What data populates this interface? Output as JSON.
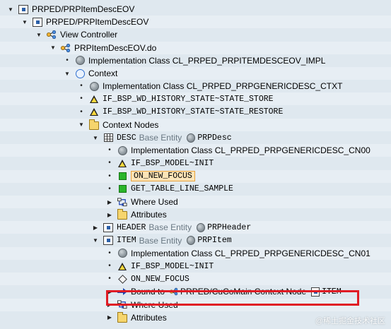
{
  "tree": [
    {
      "id": "root",
      "depth": 0,
      "toggle": "open",
      "icon": "node-box-icon",
      "segs": [
        {
          "t": "PRPED/PRPItemDescEOV",
          "s": "plain"
        }
      ]
    },
    {
      "id": "component",
      "depth": 1,
      "toggle": "open",
      "icon": "node-box-icon",
      "segs": [
        {
          "t": "PRPED/PRPItemDescEOV",
          "s": "plain"
        }
      ]
    },
    {
      "id": "view-controller",
      "depth": 2,
      "toggle": "open",
      "icon": "network-icon",
      "segs": [
        {
          "t": "View Controller",
          "s": "plain"
        }
      ]
    },
    {
      "id": "view",
      "depth": 3,
      "toggle": "open",
      "icon": "network-icon",
      "segs": [
        {
          "t": "PRPItemDescEOV.do",
          "s": "plain"
        }
      ]
    },
    {
      "id": "view-impl",
      "depth": 4,
      "toggle": "leaf",
      "icon": "class-circle-icon",
      "segs": [
        {
          "t": "Implementation Class CL_PRPED_PRPITEMDESCEOV_IMPL",
          "s": "plain"
        }
      ]
    },
    {
      "id": "context",
      "depth": 4,
      "toggle": "open",
      "icon": "context-ring-icon",
      "segs": [
        {
          "t": "Context",
          "s": "plain"
        }
      ]
    },
    {
      "id": "ctxt-impl",
      "depth": 5,
      "toggle": "leaf",
      "icon": "class-circle-icon",
      "segs": [
        {
          "t": "Implementation Class CL_PRPED_PRPGENERICDESC_CTXT",
          "s": "plain"
        }
      ]
    },
    {
      "id": "hist-store",
      "depth": 5,
      "toggle": "leaf",
      "icon": "warning-triangle-icon",
      "segs": [
        {
          "t": "IF_BSP_WD_HISTORY_STATE~STATE_STORE",
          "s": "mono"
        }
      ]
    },
    {
      "id": "hist-restore",
      "depth": 5,
      "toggle": "leaf",
      "icon": "warning-triangle-icon",
      "segs": [
        {
          "t": "IF_BSP_WD_HISTORY_STATE~STATE_RESTORE",
          "s": "mono"
        }
      ]
    },
    {
      "id": "context-nodes",
      "depth": 5,
      "toggle": "open",
      "icon": "folder-icon",
      "segs": [
        {
          "t": "Context Nodes",
          "s": "plain"
        }
      ]
    },
    {
      "id": "desc",
      "depth": 6,
      "toggle": "open",
      "icon": "table-grid-icon",
      "segs": [
        {
          "t": "DESC",
          "s": "mono"
        },
        {
          "t": "Base Entity",
          "s": "gray"
        },
        {
          "t": "",
          "s": "icon",
          "icon": "class-circle-icon"
        },
        {
          "t": "PRPDesc",
          "s": "mono"
        }
      ]
    },
    {
      "id": "desc-impl",
      "depth": 7,
      "toggle": "leaf",
      "icon": "class-circle-icon",
      "segs": [
        {
          "t": "Implementation Class CL_PRPED_PRPGENERICDESC_CN00",
          "s": "plain"
        }
      ]
    },
    {
      "id": "desc-init",
      "depth": 7,
      "toggle": "leaf",
      "icon": "warning-triangle-icon",
      "segs": [
        {
          "t": "IF_BSP_MODEL~INIT",
          "s": "mono"
        }
      ]
    },
    {
      "id": "desc-focus",
      "depth": 7,
      "toggle": "leaf",
      "icon": "green-square-icon",
      "selected": true,
      "segs": [
        {
          "t": "ON_NEW_FOCUS",
          "s": "mono-boxed"
        }
      ]
    },
    {
      "id": "desc-getline",
      "depth": 7,
      "toggle": "leaf",
      "icon": "green-square-icon",
      "segs": [
        {
          "t": "GET_TABLE_LINE_SAMPLE",
          "s": "mono"
        }
      ]
    },
    {
      "id": "desc-where",
      "depth": 7,
      "toggle": "closed",
      "icon": "where-used-icon",
      "segs": [
        {
          "t": "Where Used",
          "s": "plain"
        }
      ]
    },
    {
      "id": "desc-attrs",
      "depth": 7,
      "toggle": "closed",
      "icon": "folder-icon",
      "segs": [
        {
          "t": "Attributes",
          "s": "plain"
        }
      ]
    },
    {
      "id": "header",
      "depth": 6,
      "toggle": "closed",
      "icon": "node-box-icon",
      "segs": [
        {
          "t": "HEADER",
          "s": "mono"
        },
        {
          "t": "Base Entity",
          "s": "gray"
        },
        {
          "t": "",
          "s": "icon",
          "icon": "class-circle-icon"
        },
        {
          "t": "PRPHeader",
          "s": "mono"
        }
      ]
    },
    {
      "id": "item",
      "depth": 6,
      "toggle": "open",
      "icon": "node-box-icon",
      "segs": [
        {
          "t": "ITEM",
          "s": "mono"
        },
        {
          "t": "Base Entity",
          "s": "gray"
        },
        {
          "t": "",
          "s": "icon",
          "icon": "class-circle-icon"
        },
        {
          "t": "PRPItem",
          "s": "mono"
        }
      ]
    },
    {
      "id": "item-impl",
      "depth": 7,
      "toggle": "leaf",
      "icon": "class-circle-icon",
      "segs": [
        {
          "t": "Implementation Class CL_PRPED_PRPGENERICDESC_CN01",
          "s": "plain"
        }
      ]
    },
    {
      "id": "item-init",
      "depth": 7,
      "toggle": "leaf",
      "icon": "warning-triangle-icon",
      "segs": [
        {
          "t": "IF_BSP_MODEL~INIT",
          "s": "mono"
        }
      ]
    },
    {
      "id": "item-focus",
      "depth": 7,
      "toggle": "leaf",
      "icon": "diamond-icon",
      "segs": [
        {
          "t": "ON_NEW_FOCUS",
          "s": "mono"
        }
      ]
    },
    {
      "id": "item-bound",
      "depth": 7,
      "toggle": "closed",
      "icon": "bound-arrow-icon",
      "segs": [
        {
          "t": "Bound to",
          "s": "plain"
        },
        {
          "t": "",
          "s": "icon",
          "icon": "network-icon"
        },
        {
          "t": "PRPED/CuCoMain Context Node",
          "s": "plain"
        },
        {
          "t": "",
          "s": "icon",
          "icon": "node-box-icon"
        },
        {
          "t": "ITEM",
          "s": "mono"
        }
      ]
    },
    {
      "id": "item-where",
      "depth": 7,
      "toggle": "closed",
      "icon": "where-used-icon",
      "segs": [
        {
          "t": "Where Used",
          "s": "plain"
        }
      ]
    },
    {
      "id": "item-attrs",
      "depth": 7,
      "toggle": "closed",
      "icon": "folder-icon",
      "segs": [
        {
          "t": "Attributes",
          "s": "plain"
        }
      ]
    }
  ],
  "watermark": "@稀土掘金技术社区",
  "colors": {
    "background": "#dfe8ef",
    "highlight": "#e01b24",
    "selection": "#fbe4b7"
  }
}
